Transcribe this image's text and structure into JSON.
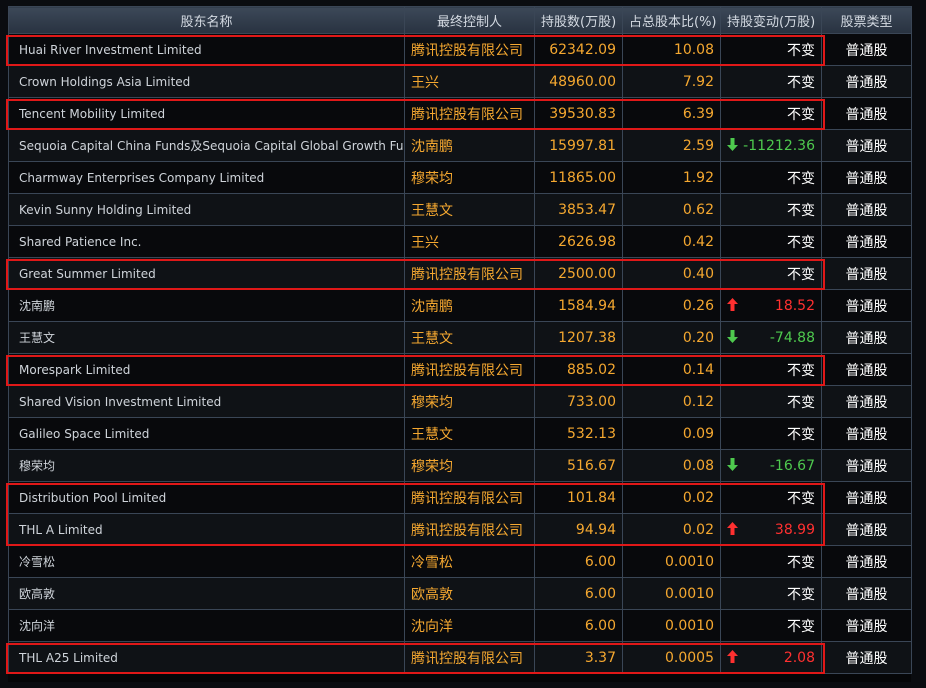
{
  "headers": [
    "股东名称",
    "最终控制人",
    "持股数(万股)",
    "占总股本比(%)",
    "持股变动(万股)",
    "股票类型"
  ],
  "rows": [
    {
      "name": "Huai River Investment Limited",
      "controller": "腾讯控股有限公司",
      "shares": "62342.09",
      "ratio": "10.08",
      "change": "不变",
      "dir": "none",
      "type": "普通股"
    },
    {
      "name": "Crown Holdings Asia Limited",
      "controller": "王兴",
      "shares": "48960.00",
      "ratio": "7.92",
      "change": "不变",
      "dir": "none",
      "type": "普通股"
    },
    {
      "name": "Tencent Mobility Limited",
      "controller": "腾讯控股有限公司",
      "shares": "39530.83",
      "ratio": "6.39",
      "change": "不变",
      "dir": "none",
      "type": "普通股"
    },
    {
      "name": "Sequoia Capital China Funds及Sequoia Capital Global Growth Funds",
      "controller": "沈南鹏",
      "shares": "15997.81",
      "ratio": "2.59",
      "change": "-11212.36",
      "dir": "down",
      "type": "普通股"
    },
    {
      "name": "Charmway Enterprises Company Limited",
      "controller": "穆荣均",
      "shares": "11865.00",
      "ratio": "1.92",
      "change": "不变",
      "dir": "none",
      "type": "普通股"
    },
    {
      "name": "Kevin Sunny Holding Limited",
      "controller": "王慧文",
      "shares": "3853.47",
      "ratio": "0.62",
      "change": "不变",
      "dir": "none",
      "type": "普通股"
    },
    {
      "name": "Shared Patience Inc.",
      "controller": "王兴",
      "shares": "2626.98",
      "ratio": "0.42",
      "change": "不变",
      "dir": "none",
      "type": "普通股"
    },
    {
      "name": "Great Summer Limited",
      "controller": "腾讯控股有限公司",
      "shares": "2500.00",
      "ratio": "0.40",
      "change": "不变",
      "dir": "none",
      "type": "普通股"
    },
    {
      "name": "沈南鹏",
      "controller": "沈南鹏",
      "shares": "1584.94",
      "ratio": "0.26",
      "change": "18.52",
      "dir": "up",
      "type": "普通股"
    },
    {
      "name": "王慧文",
      "controller": "王慧文",
      "shares": "1207.38",
      "ratio": "0.20",
      "change": "-74.88",
      "dir": "down",
      "type": "普通股"
    },
    {
      "name": "Morespark Limited",
      "controller": "腾讯控股有限公司",
      "shares": "885.02",
      "ratio": "0.14",
      "change": "不变",
      "dir": "none",
      "type": "普通股"
    },
    {
      "name": "Shared Vision Investment Limited",
      "controller": "穆荣均",
      "shares": "733.00",
      "ratio": "0.12",
      "change": "不变",
      "dir": "none",
      "type": "普通股"
    },
    {
      "name": "Galileo Space Limited",
      "controller": "王慧文",
      "shares": "532.13",
      "ratio": "0.09",
      "change": "不变",
      "dir": "none",
      "type": "普通股"
    },
    {
      "name": "穆荣均",
      "controller": "穆荣均",
      "shares": "516.67",
      "ratio": "0.08",
      "change": "-16.67",
      "dir": "down",
      "type": "普通股"
    },
    {
      "name": "Distribution Pool Limited",
      "controller": "腾讯控股有限公司",
      "shares": "101.84",
      "ratio": "0.02",
      "change": "不变",
      "dir": "none",
      "type": "普通股"
    },
    {
      "name": "THL A Limited",
      "controller": "腾讯控股有限公司",
      "shares": "94.94",
      "ratio": "0.02",
      "change": "38.99",
      "dir": "up",
      "type": "普通股"
    },
    {
      "name": "冷雪松",
      "controller": "冷雪松",
      "shares": "6.00",
      "ratio": "0.0010",
      "change": "不变",
      "dir": "none",
      "type": "普通股"
    },
    {
      "name": "欧高敦",
      "controller": "欧高敦",
      "shares": "6.00",
      "ratio": "0.0010",
      "change": "不变",
      "dir": "none",
      "type": "普通股"
    },
    {
      "name": "沈向洋",
      "controller": "沈向洋",
      "shares": "6.00",
      "ratio": "0.0010",
      "change": "不变",
      "dir": "none",
      "type": "普通股"
    },
    {
      "name": "THL A25 Limited",
      "controller": "腾讯控股有限公司",
      "shares": "3.37",
      "ratio": "0.0005",
      "change": "2.08",
      "dir": "up",
      "type": "普通股"
    }
  ],
  "highlighted_rows": [
    [
      0
    ],
    [
      2
    ],
    [
      7
    ],
    [
      10
    ],
    [
      14,
      15
    ],
    [
      19
    ]
  ],
  "colors": {
    "up": "#ff3030",
    "down": "#4ec94e",
    "value": "#f5a830",
    "highlight": "#e01818"
  }
}
